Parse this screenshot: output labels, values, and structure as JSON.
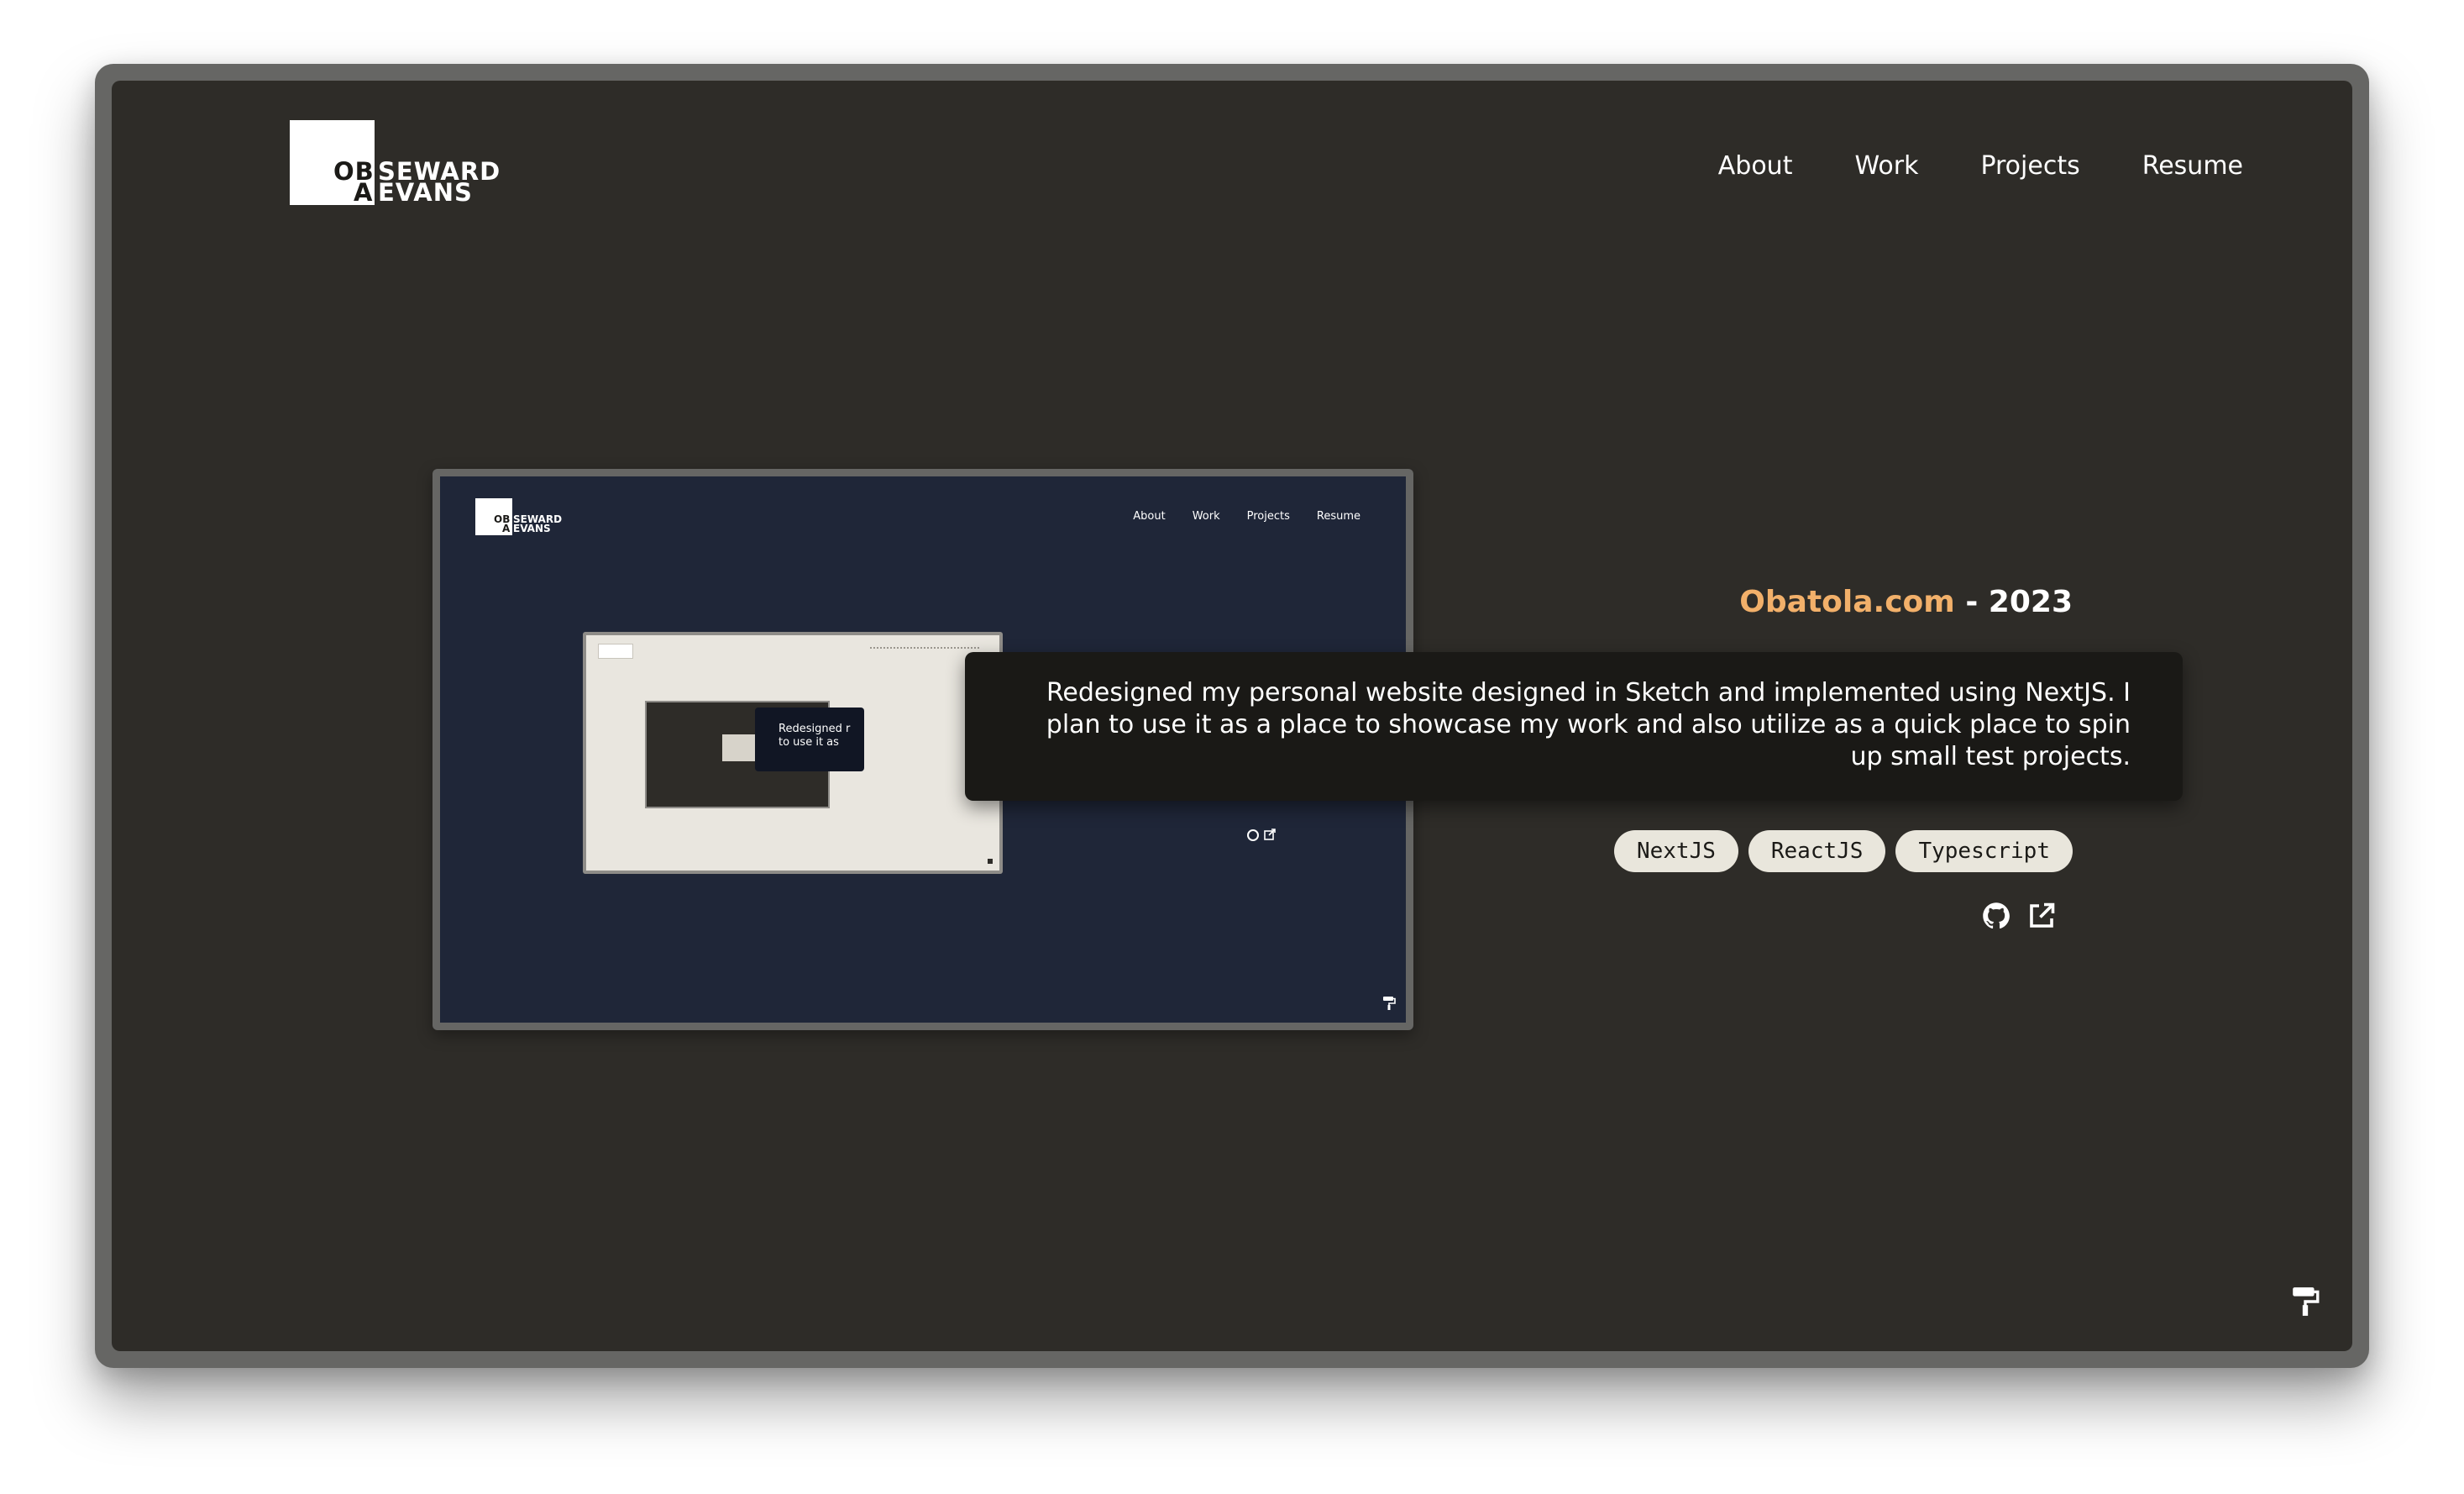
{
  "logo": {
    "mark": "OB",
    "sub": "A",
    "line1": "SEWARD",
    "line2": "EVANS"
  },
  "nav": {
    "about": "About",
    "work": "Work",
    "projects": "Projects",
    "resume": "Resume"
  },
  "preview": {
    "nav": {
      "about": "About",
      "work": "Work",
      "projects": "Projects",
      "resume": "Resume"
    },
    "nested_text_1": "Redesigned r",
    "nested_text_2": "to use it as"
  },
  "project": {
    "name": "Obatola.com",
    "separator": " - ",
    "year": "2023",
    "description": "Redesigned my personal website designed in Sketch and implemented using NextJS. I plan to use it as a place to showcase my work and also utilize as a quick place to spin up small test projects.",
    "tags": [
      "NextJS",
      "ReactJS",
      "Typescript"
    ]
  },
  "icons": {
    "github": "github-icon",
    "external": "external-link-icon",
    "theme": "paint-roller-icon"
  },
  "colors": {
    "background": "#2e2c28",
    "accent": "#f2b06a",
    "card": "#1a1916",
    "tag": "#e9e6dc"
  }
}
